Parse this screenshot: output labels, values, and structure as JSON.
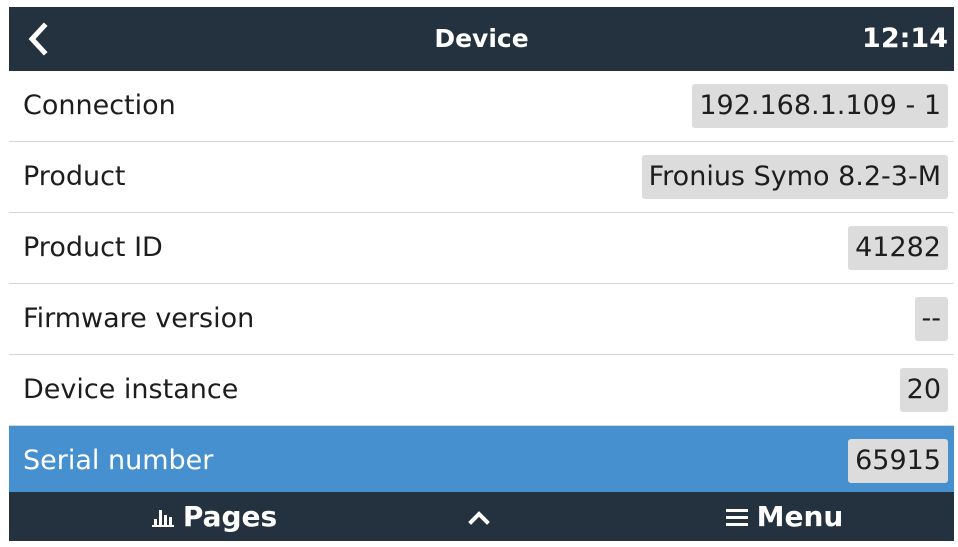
{
  "header": {
    "title": "Device",
    "time": "12:14"
  },
  "rows": [
    {
      "label": "Connection",
      "value": "192.168.1.109 - 1"
    },
    {
      "label": "Product",
      "value": "Fronius Symo 8.2-3-M"
    },
    {
      "label": "Product ID",
      "value": "41282"
    },
    {
      "label": "Firmware version",
      "value": "--"
    },
    {
      "label": "Device instance",
      "value": "20"
    },
    {
      "label": "Serial number",
      "value": "65915"
    }
  ],
  "footer": {
    "pages_label": "Pages",
    "menu_label": "Menu"
  },
  "icons": {
    "back": "chevron-left-icon",
    "pages": "bar-chart-icon",
    "up": "chevron-up-icon",
    "menu": "hamburger-menu-icon"
  },
  "colors": {
    "bar_background": "#243240",
    "selected_row": "#4790d0",
    "value_badge": "#dcdcdc"
  }
}
